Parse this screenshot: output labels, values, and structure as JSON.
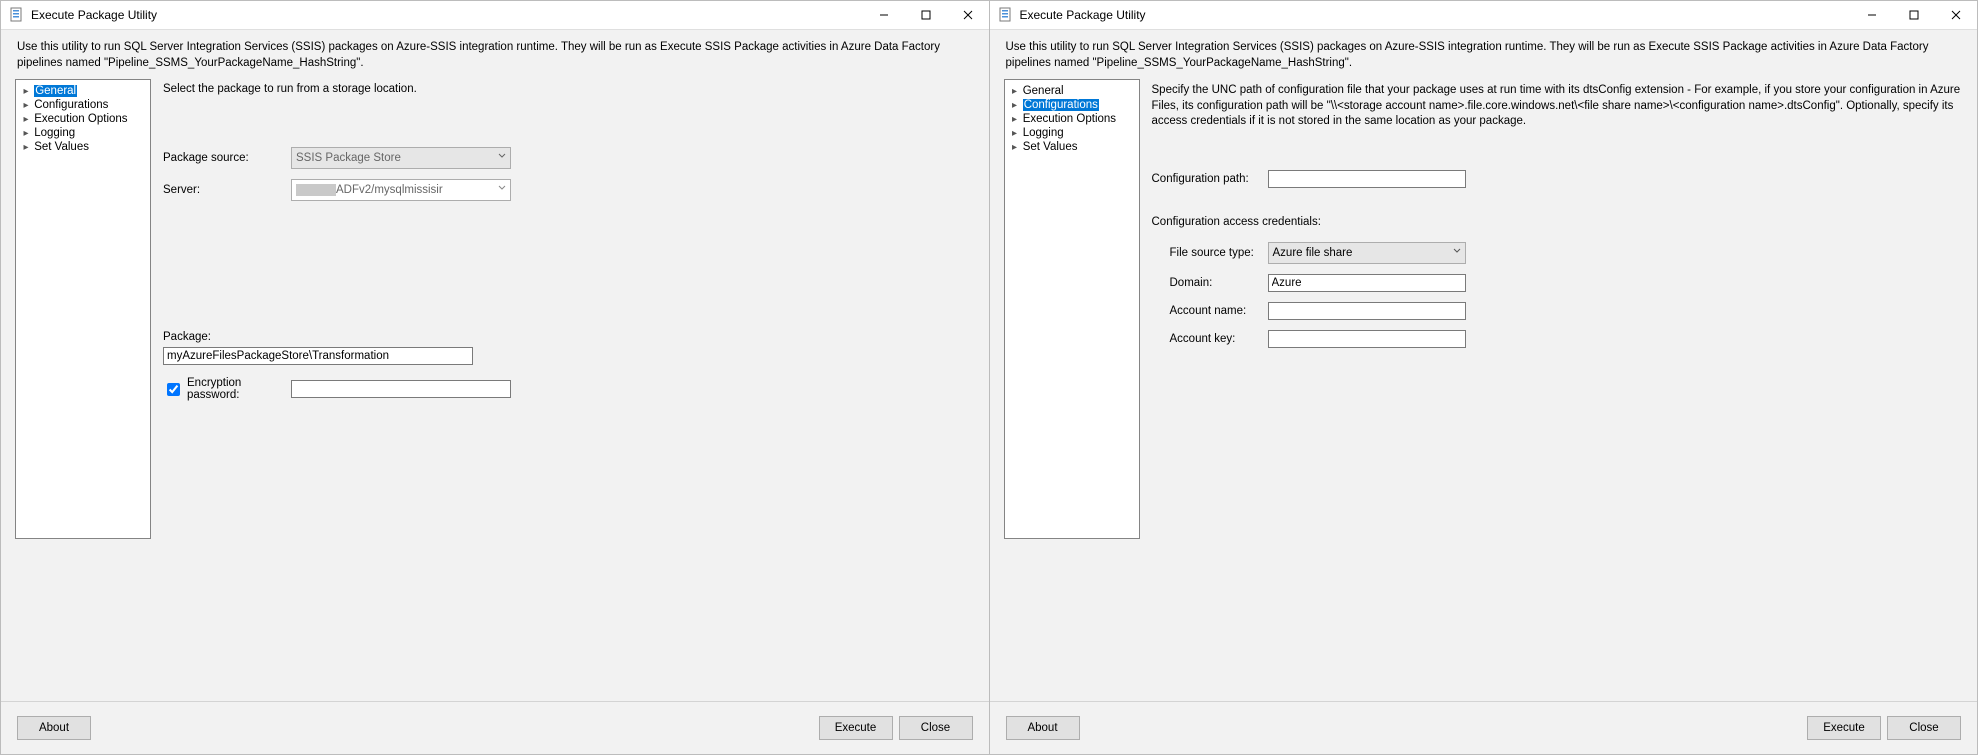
{
  "window_title": "Execute Package Utility",
  "description": "Use this utility to run SQL Server Integration Services (SSIS) packages on Azure-SSIS integration runtime. They will be run as Execute SSIS Package activities in Azure Data Factory pipelines named \"Pipeline_SSMS_YourPackageName_HashString\".",
  "nav": {
    "items": [
      "General",
      "Configurations",
      "Execution Options",
      "Logging",
      "Set Values"
    ]
  },
  "general": {
    "instruction": "Select the package to run from a storage location.",
    "labels": {
      "package_source": "Package source:",
      "server": "Server:",
      "package": "Package:",
      "encryption_password": "Encryption password:"
    },
    "values": {
      "package_source": "SSIS Package Store",
      "server_suffix": "ADFv2/mysqlmissisir",
      "package": "myAzureFilesPackageStore\\Transformation",
      "encryption_password": ""
    }
  },
  "configurations": {
    "instruction": "Specify the UNC path of configuration file that your package uses at run time with its dtsConfig extension - For example, if you store your configuration in Azure Files, its configuration path will be \"\\\\<storage account name>.file.core.windows.net\\<file share name>\\<configuration name>.dtsConfig\".  Optionally, specify its access credentials if it is not stored in the same location as your package.",
    "labels": {
      "configuration_path": "Configuration path:",
      "credentials_header": "Configuration access credentials:",
      "file_source_type": "File source type:",
      "domain": "Domain:",
      "account_name": "Account name:",
      "account_key": "Account key:"
    },
    "values": {
      "configuration_path": "",
      "file_source_type": "Azure file share",
      "domain": "Azure",
      "account_name": "",
      "account_key": ""
    }
  },
  "buttons": {
    "about": "About",
    "execute": "Execute",
    "close": "Close"
  }
}
